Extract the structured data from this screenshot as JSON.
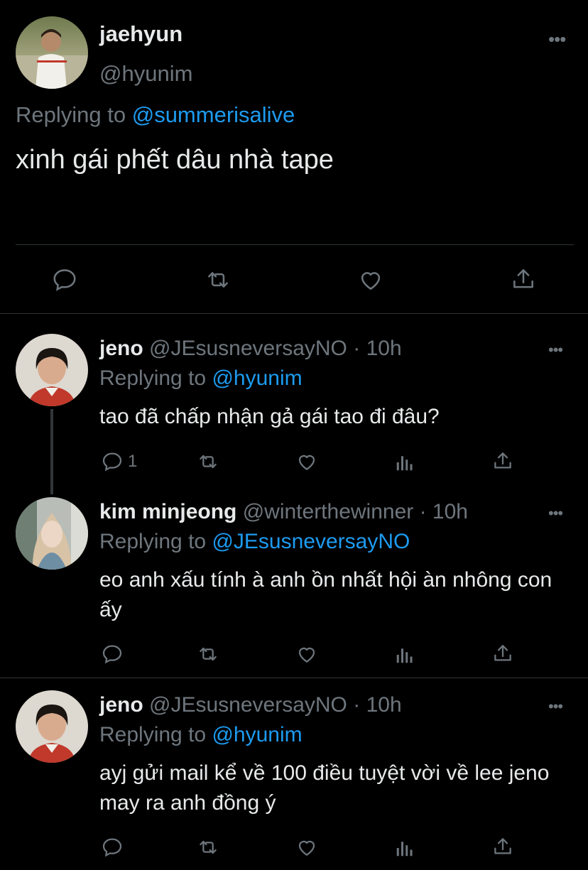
{
  "main_tweet": {
    "name": "jaehyun",
    "handle": "@hyunim",
    "replying_prefix": "Replying to ",
    "replying_to": "@summerisalive",
    "text": "xinh gái phết dâu nhà tape",
    "actions": [
      "reply-icon",
      "retweet-icon",
      "like-icon",
      "share-icon"
    ]
  },
  "replies": [
    {
      "name": "jeno",
      "handle": "@JEsusneversayNO",
      "time": "· 10h",
      "replying_prefix": "Replying to ",
      "replying_to": "@hyunim",
      "text": "tao đã chấp nhận gả gái tao đi đâu?",
      "reply_count": "1"
    },
    {
      "name": "kim minjeong",
      "handle": "@winterthewinner",
      "time": "· 10h",
      "replying_prefix": "Replying to ",
      "replying_to": "@JEsusneversayNO",
      "text": "eo anh xấu tính à anh ồn nhất hội àn nhông con ấy",
      "reply_count": ""
    },
    {
      "name": "jeno",
      "handle": "@JEsusneversayNO",
      "time": "· 10h",
      "replying_prefix": "Replying to ",
      "replying_to": "@hyunim",
      "text": "ayj gửi mail kể về 100 điều tuyệt vời về lee jeno may ra anh đồng ý",
      "reply_count": ""
    }
  ],
  "colors": {
    "background": "#000000",
    "text": "#e7e9ea",
    "muted": "#6e767d",
    "link": "#1d9bf0",
    "divider": "#2f3336"
  }
}
